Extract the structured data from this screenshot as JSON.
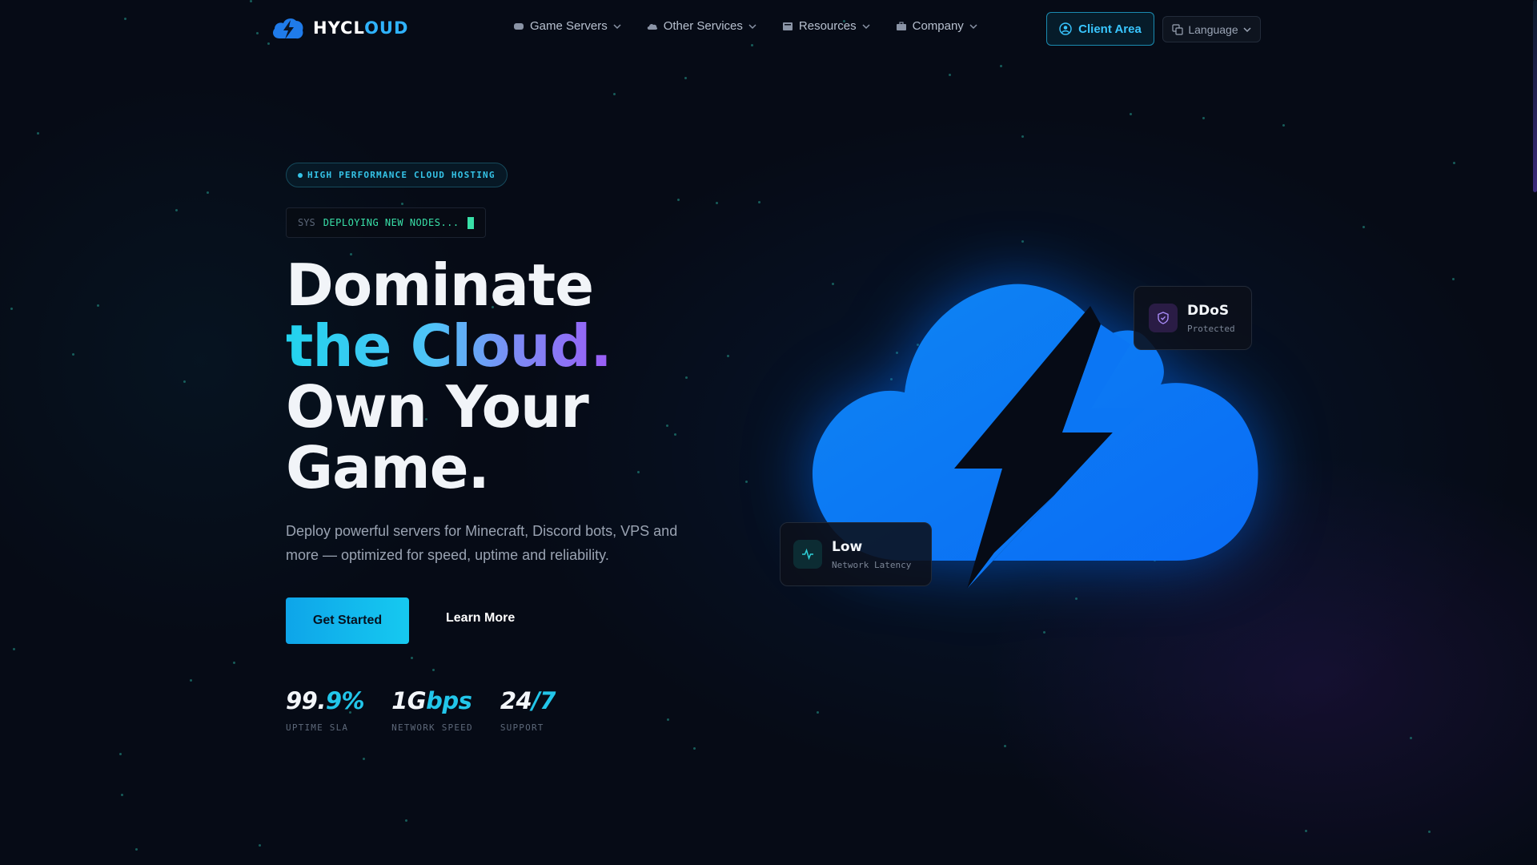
{
  "brand": {
    "name_main": "HYCL",
    "name_accent": "OUD",
    "logo_icon": "cloud-bolt-icon"
  },
  "nav": {
    "items": [
      {
        "label": "Game Servers",
        "icon": "gamepad-icon"
      },
      {
        "label": "Other Services",
        "icon": "cloud-icon"
      },
      {
        "label": "Resources",
        "icon": "book-icon"
      },
      {
        "label": "Company",
        "icon": "briefcase-icon"
      }
    ],
    "client_area": "Client Area",
    "language": "Language"
  },
  "hero": {
    "badge": "HIGH PERFORMANCE CLOUD HOSTING",
    "sys_label": "SYS",
    "sys_text": "DEPLOYING NEW NODES...",
    "headline_1": "Dominate",
    "headline_2": "the Cloud.",
    "headline_3": "Own Your",
    "headline_4": "Game.",
    "subtitle": "Deploy powerful servers for Minecraft, Discord bots, VPS and more — optimized for speed, uptime and reliability.",
    "cta_primary": "Get Started",
    "cta_secondary": "Learn More"
  },
  "stats": [
    {
      "value_main": "99.",
      "value_accent": "9%",
      "label": "UPTIME SLA"
    },
    {
      "value_main": "1G",
      "value_accent": "bps",
      "label": "NETWORK SPEED"
    },
    {
      "value_main": "24",
      "value_accent": "/7",
      "label": "SUPPORT"
    }
  ],
  "cards": {
    "ddos": {
      "title": "DDoS",
      "meta": "Protected",
      "icon": "shield-icon"
    },
    "latency": {
      "title": "Low",
      "meta": "Network Latency",
      "icon": "activity-icon"
    }
  },
  "colors": {
    "background": "#060b16",
    "accent_cyan": "#22d3ee",
    "accent_blue": "#0b7cff",
    "accent_purple": "#9b5cf6"
  }
}
